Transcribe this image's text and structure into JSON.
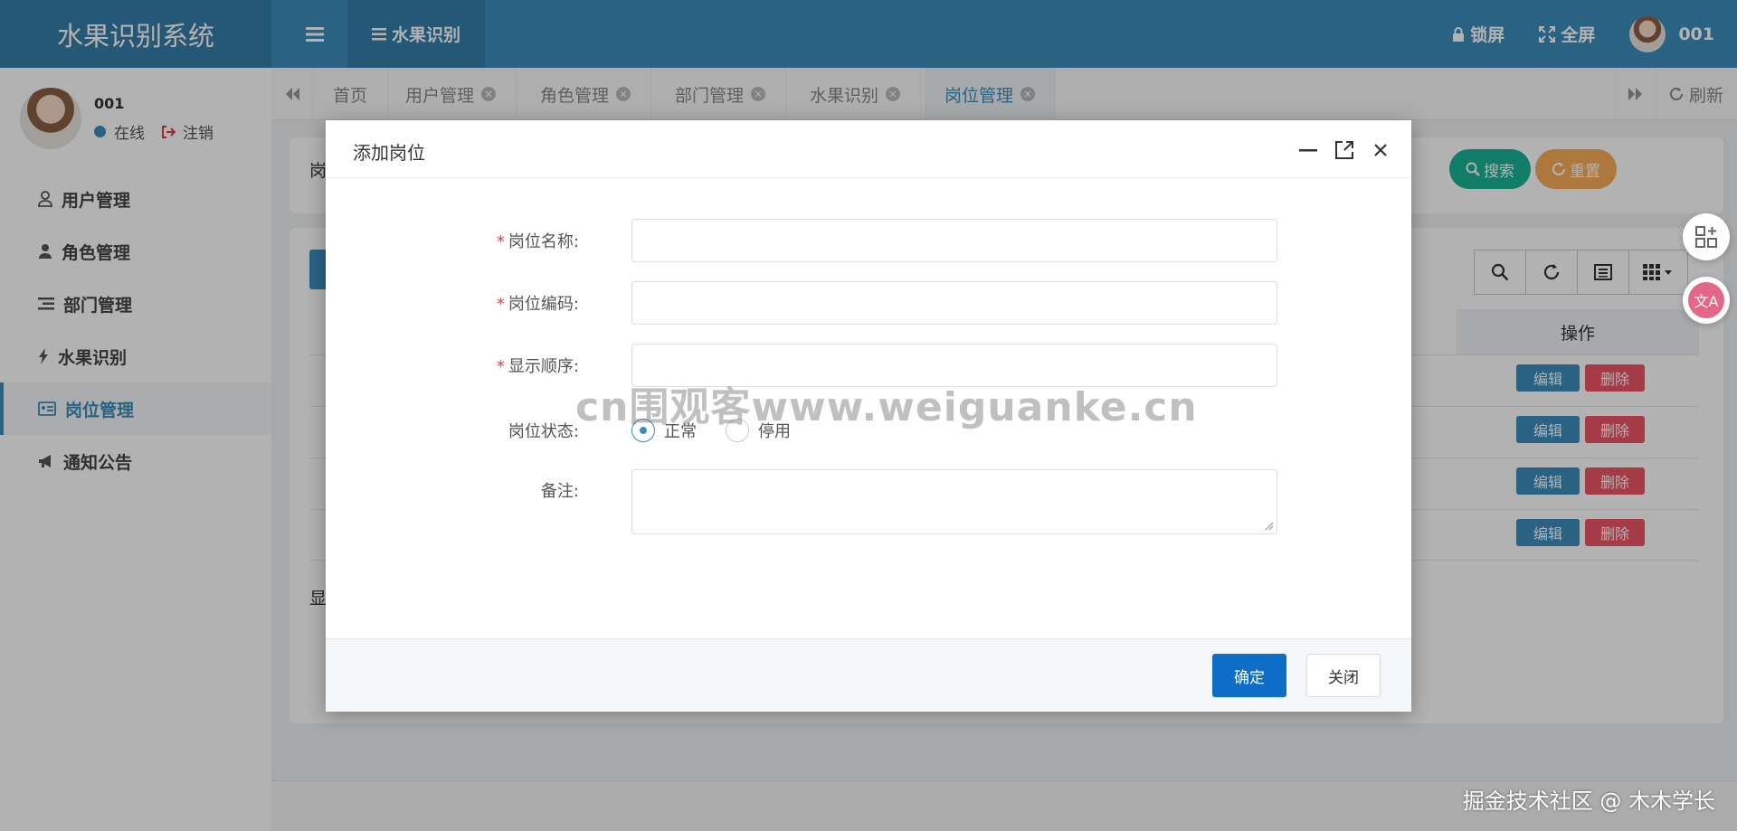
{
  "header": {
    "logo": "水果识别系统",
    "nav_menu": "水果识别",
    "lock": "锁屏",
    "fullscreen": "全屏",
    "user": "001"
  },
  "sidebar": {
    "user_name": "001",
    "status": "在线",
    "logout": "注销",
    "items": [
      {
        "label": "用户管理",
        "icon": "user-icon"
      },
      {
        "label": "角色管理",
        "icon": "role-icon"
      },
      {
        "label": "部门管理",
        "icon": "dept-icon"
      },
      {
        "label": "水果识别",
        "icon": "bolt-icon"
      },
      {
        "label": "岗位管理",
        "icon": "id-card-icon",
        "active": true
      },
      {
        "label": "通知公告",
        "icon": "bullhorn-icon"
      }
    ]
  },
  "tabs": [
    "首页",
    "用户管理",
    "角色管理",
    "部门管理",
    "水果识别",
    "岗位管理"
  ],
  "tab_refresh": "刷新",
  "search": {
    "label_partial": "岗",
    "search_btn": "搜索",
    "reset_btn": "重置"
  },
  "table": {
    "op_header": "操作",
    "edit": "编辑",
    "delete": "删除",
    "row_count": 4,
    "footer_partial": "显"
  },
  "modal": {
    "title": "添加岗位",
    "fields": {
      "post_name": "岗位名称:",
      "post_code": "岗位编码:",
      "post_sort": "显示顺序:",
      "status": "岗位状态:",
      "remark": "备注:"
    },
    "status_options": [
      "正常",
      "停用"
    ],
    "confirm": "确定",
    "close": "关闭"
  },
  "watermark": "cn围观客www.weiguanke.cn",
  "credit": "掘金技术社区 @ 木木学长"
}
